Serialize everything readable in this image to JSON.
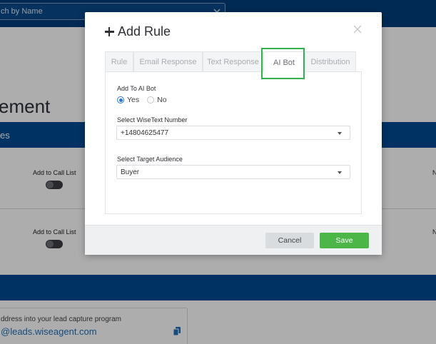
{
  "background": {
    "search_placeholder": "ch by Name",
    "heading": "ement",
    "section_band_label": "es",
    "rows": [
      {
        "label": "Add to Call List",
        "right_text": "N"
      },
      {
        "label": "Add to Call List",
        "right_text": "N"
      }
    ],
    "email_card": {
      "line1": "ddress into your lead capture program",
      "line2": "@leads.wiseagent.com"
    }
  },
  "modal": {
    "title": "Add Rule",
    "tabs": [
      {
        "label": "Rule",
        "active": false
      },
      {
        "label": "Email Response",
        "active": false
      },
      {
        "label": "Text Response",
        "active": false
      },
      {
        "label": "AI Bot",
        "active": true
      },
      {
        "label": "Distribution",
        "active": false
      }
    ],
    "add_to_ai_bot": {
      "label": "Add To AI Bot",
      "options": [
        {
          "label": "Yes",
          "checked": true
        },
        {
          "label": "No",
          "checked": false
        }
      ]
    },
    "wisetext_number": {
      "label": "Select WiseText Number",
      "value": "+14804625477"
    },
    "target_audience": {
      "label": "Select Target Audience",
      "value": "Buyer"
    },
    "buttons": {
      "cancel": "Cancel",
      "save": "Save"
    }
  },
  "colors": {
    "nav_blue": "#003f7d",
    "band_blue": "#004a94",
    "save_green": "#4cb748",
    "highlight_green": "#2fb34a",
    "radio_blue": "#2a78d6"
  },
  "icons": [
    "plus-icon",
    "close-icon",
    "chevron-down-icon",
    "copy-icon",
    "caret-down-icon"
  ]
}
